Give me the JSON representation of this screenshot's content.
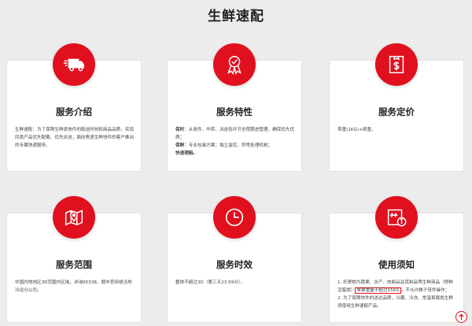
{
  "page": {
    "title": "生鲜速配"
  },
  "cards": {
    "intro": {
      "title": "服务介绍",
      "icon": "truck-icon",
      "text": "生鲜速配：为了保障生鲜类快件的配送时效和商品品质，实现同类产品优先配载、优先派送，面向寄递生鲜快件的客户推出的专属快递服务。"
    },
    "features": {
      "title": "服务特性",
      "icon": "award-ribbon-icon",
      "p1_label": "保时",
      "p1_text": "：从收件、中转、派送各环节全程跟进管理，确保优先优质；",
      "p2_label": "保鲜",
      "p2_text": "：专业包装方案；独立监控、异常处理机制；",
      "p3_text": "快速理赔。"
    },
    "pricing": {
      "title": "服务定价",
      "icon": "price-box-icon",
      "text": "首重(1KG)+续重。"
    },
    "range": {
      "title": "服务范围",
      "icon": "map-pin-icon",
      "text": "中国内地地区3D范围内区域，详询95338、顺丰官网或当地冷运分公司。"
    },
    "timeliness": {
      "title": "服务时效",
      "icon": "clock-icon",
      "text": "整体不超过3D（第三天23:59分）。"
    },
    "notice": {
      "title": "使用须知",
      "icon": "package-info-icon",
      "item1_pre": "1. 托寄物为蔬果、水产、肉制品及其制品等生鲜商品（除鲜活腊类）",
      "item1_highlight": "单票重量不超过15KG",
      "item1_post": "，不允许做子母件操作；",
      "item2": "2. 为了保障快件的送达品质，冷藏、冷冻、常温易腐类生鲜须使用生鲜速配产品。"
    }
  },
  "colors": {
    "accent": "#e0101e",
    "background": "#ececec",
    "card": "#ffffff"
  },
  "back_to_top": {
    "icon": "arrow-up-icon"
  }
}
